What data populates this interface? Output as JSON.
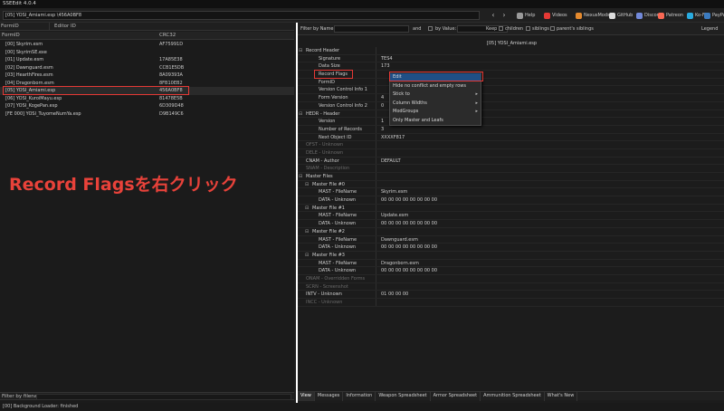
{
  "window": {
    "title": "SSEEdit 4.0.4"
  },
  "toolbar": {
    "path": "[05] YOSI_Amiami.esp \\456A0BF8",
    "back_icon": "back-arrow-icon",
    "forward_icon": "forward-arrow-icon",
    "links": [
      {
        "label": "Help",
        "icon": "help-icon",
        "color": "#9a9a9a"
      },
      {
        "label": "Videos",
        "icon": "videos-icon",
        "color": "#e53935"
      },
      {
        "label": "NexusMods",
        "icon": "nexusmods-icon",
        "color": "#e58a2e"
      },
      {
        "label": "GitHub",
        "icon": "github-icon",
        "color": "#dddddd"
      },
      {
        "label": "Discord",
        "icon": "discord-icon",
        "color": "#7289da"
      },
      {
        "label": "Patreon",
        "icon": "patreon-icon",
        "color": "#f96854"
      },
      {
        "label": "Ko-Fi",
        "icon": "kofi-icon",
        "color": "#29abe0"
      },
      {
        "label": "PayPal",
        "icon": "paypal-icon",
        "color": "#3b7bbf"
      }
    ]
  },
  "left": {
    "formid_placeholder": "FormID",
    "editorid_placeholder": "Editor ID",
    "columns": {
      "formid": "FormID",
      "crc": "CRC32"
    },
    "files": [
      {
        "name": "[00] Skyrim.esm",
        "crc": "AF75991D"
      },
      {
        "name": "[00] SkyrimSE.exe",
        "crc": ""
      },
      {
        "name": "[01] Update.esm",
        "crc": "17A85E38"
      },
      {
        "name": "[02] Dawnguard.esm",
        "crc": "CCB1E5DB"
      },
      {
        "name": "[03] HearthFires.esm",
        "crc": "8A09393A"
      },
      {
        "name": "[04] Dragonborn.esm",
        "crc": "8FB10EB2"
      },
      {
        "name": "[05] YOSI_Amiami.esp",
        "crc": "456A0BF8"
      },
      {
        "name": "[06] YOSI_KuroiMayu.esp",
        "crc": "81478E5B"
      },
      {
        "name": "[07] YOSI_KogePan.esp",
        "crc": "6D309D48"
      },
      {
        "name": "[FE 000] YOSI_TuyomeNumYa.esp",
        "crc": "D9B149C6"
      }
    ],
    "annotation": "Record Flagsを右クリック",
    "filter_label": "Filter by filename:"
  },
  "status": {
    "text": "[00] Background Loader: finished"
  },
  "right": {
    "filter": {
      "by_name": "Filter by Name:",
      "and": "and",
      "by_value": "by Value:",
      "keep": "Keep",
      "children": "children",
      "siblings": "siblings",
      "parents_siblings": "parent's siblings",
      "legend": "Legend"
    },
    "record_title": "[05] YOSI_Amiami.esp",
    "tree": [
      {
        "name": "Record Header",
        "value": "",
        "indent": 0,
        "dim": false,
        "exp": "−"
      },
      {
        "name": "Signature",
        "value": "TES4",
        "indent": 2,
        "dim": false,
        "exp": ""
      },
      {
        "name": "Data Size",
        "value": "173",
        "indent": 2,
        "dim": false,
        "exp": ""
      },
      {
        "name": "Record Flags",
        "value": "",
        "indent": 2,
        "dim": false,
        "exp": ""
      },
      {
        "name": "FormID",
        "value": "",
        "indent": 2,
        "dim": false,
        "exp": ""
      },
      {
        "name": "Version Control Info 1",
        "value": "",
        "indent": 2,
        "dim": false,
        "exp": ""
      },
      {
        "name": "Form Version",
        "value": "4",
        "indent": 2,
        "dim": false,
        "exp": ""
      },
      {
        "name": "Version Control Info 2",
        "value": "0",
        "indent": 2,
        "dim": false,
        "exp": ""
      },
      {
        "name": "HEDR - Header",
        "value": "",
        "indent": 0,
        "dim": false,
        "exp": "−"
      },
      {
        "name": "Version",
        "value": "1",
        "indent": 2,
        "dim": false,
        "exp": ""
      },
      {
        "name": "Number of Records",
        "value": "3",
        "indent": 2,
        "dim": false,
        "exp": ""
      },
      {
        "name": "Next Object ID",
        "value": "XXXXF817",
        "indent": 2,
        "dim": false,
        "exp": ""
      },
      {
        "name": "OFST - Unknown",
        "value": "",
        "indent": 0,
        "dim": true,
        "exp": ""
      },
      {
        "name": "DELE - Unknown",
        "value": "",
        "indent": 0,
        "dim": true,
        "exp": ""
      },
      {
        "name": "CNAM - Author",
        "value": "DEFAULT",
        "indent": 0,
        "dim": false,
        "exp": ""
      },
      {
        "name": "SNAM - Description",
        "value": "",
        "indent": 0,
        "dim": true,
        "exp": ""
      },
      {
        "name": "Master Files",
        "value": "",
        "indent": 0,
        "dim": false,
        "exp": "−"
      },
      {
        "name": "Master File #0",
        "value": "",
        "indent": 1,
        "dim": false,
        "exp": "−"
      },
      {
        "name": "MAST - FileName",
        "value": "Skyrim.esm",
        "indent": 2,
        "dim": false,
        "exp": ""
      },
      {
        "name": "DATA - Unknown",
        "value": "00 00 00 00 00 00 00 00",
        "indent": 2,
        "dim": false,
        "exp": ""
      },
      {
        "name": "Master File #1",
        "value": "",
        "indent": 1,
        "dim": false,
        "exp": "−"
      },
      {
        "name": "MAST - FileName",
        "value": "Update.esm",
        "indent": 2,
        "dim": false,
        "exp": ""
      },
      {
        "name": "DATA - Unknown",
        "value": "00 00 00 00 00 00 00 00",
        "indent": 2,
        "dim": false,
        "exp": ""
      },
      {
        "name": "Master File #2",
        "value": "",
        "indent": 1,
        "dim": false,
        "exp": "−"
      },
      {
        "name": "MAST - FileName",
        "value": "Dawnguard.esm",
        "indent": 2,
        "dim": false,
        "exp": ""
      },
      {
        "name": "DATA - Unknown",
        "value": "00 00 00 00 00 00 00 00",
        "indent": 2,
        "dim": false,
        "exp": ""
      },
      {
        "name": "Master File #3",
        "value": "",
        "indent": 1,
        "dim": false,
        "exp": "−"
      },
      {
        "name": "MAST - FileName",
        "value": "Dragonborn.esm",
        "indent": 2,
        "dim": false,
        "exp": ""
      },
      {
        "name": "DATA - Unknown",
        "value": "00 00 00 00 00 00 00 00",
        "indent": 2,
        "dim": false,
        "exp": ""
      },
      {
        "name": "ONAM - Overridden Forms",
        "value": "",
        "indent": 0,
        "dim": true,
        "exp": ""
      },
      {
        "name": "SCRN - Screenshot",
        "value": "",
        "indent": 0,
        "dim": true,
        "exp": ""
      },
      {
        "name": "INTV - Unknown",
        "value": "01 00 00 00",
        "indent": 0,
        "dim": false,
        "exp": ""
      },
      {
        "name": "INCC - Unknown",
        "value": "",
        "indent": 0,
        "dim": true,
        "exp": ""
      }
    ],
    "context_menu": [
      {
        "label": "Edit",
        "submenu": false
      },
      {
        "label": "Hide no conflict and empty rows",
        "submenu": false
      },
      {
        "label": "Stick to",
        "submenu": true
      },
      {
        "label": "Column Widths",
        "submenu": true
      },
      {
        "label": "ModGroups",
        "submenu": true
      },
      {
        "label": "Only Master and Leafs",
        "submenu": false
      }
    ],
    "tabs": [
      "View",
      "Messages",
      "Information",
      "Weapon Spreadsheet",
      "Armor Spreadsheet",
      "Ammunition Spreadsheet",
      "What's New"
    ]
  }
}
